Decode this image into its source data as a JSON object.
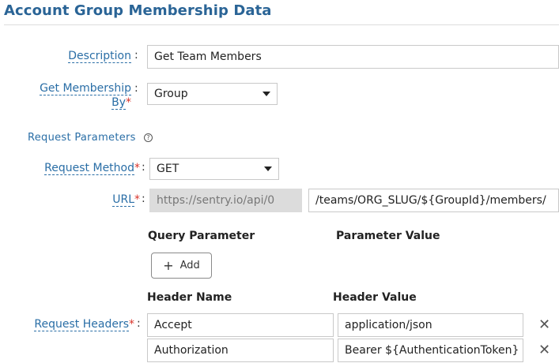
{
  "page": {
    "title": "Account Group Membership Data"
  },
  "description": {
    "label": "Description",
    "value": "Get Team Members"
  },
  "membership_by": {
    "label_line1": "Get Membership",
    "label_line2": "By",
    "required_mark": "*",
    "selected": "Group"
  },
  "request_parameters": {
    "label": "Request Parameters"
  },
  "request_method": {
    "label": "Request Method",
    "required_mark": "*",
    "selected": "GET"
  },
  "url": {
    "label": "URL",
    "required_mark": "*",
    "base": "https://sentry.io/api/0",
    "path": "/teams/ORG_SLUG/${GroupId}/members/"
  },
  "query_params": {
    "header_name": "Query Parameter",
    "header_value": "Parameter Value",
    "add_label": "Add"
  },
  "request_headers": {
    "label": "Request Headers",
    "required_mark": "*",
    "header_name": "Header Name",
    "header_value": "Header Value",
    "rows": [
      {
        "name": "Accept",
        "value": "application/json"
      },
      {
        "name": "Authorization",
        "value": "Bearer ${AuthenticationToken}"
      }
    ]
  },
  "common": {
    "colon": ":",
    "remove_glyph": "✕",
    "plus_glyph": "+",
    "help_glyph": "?"
  }
}
